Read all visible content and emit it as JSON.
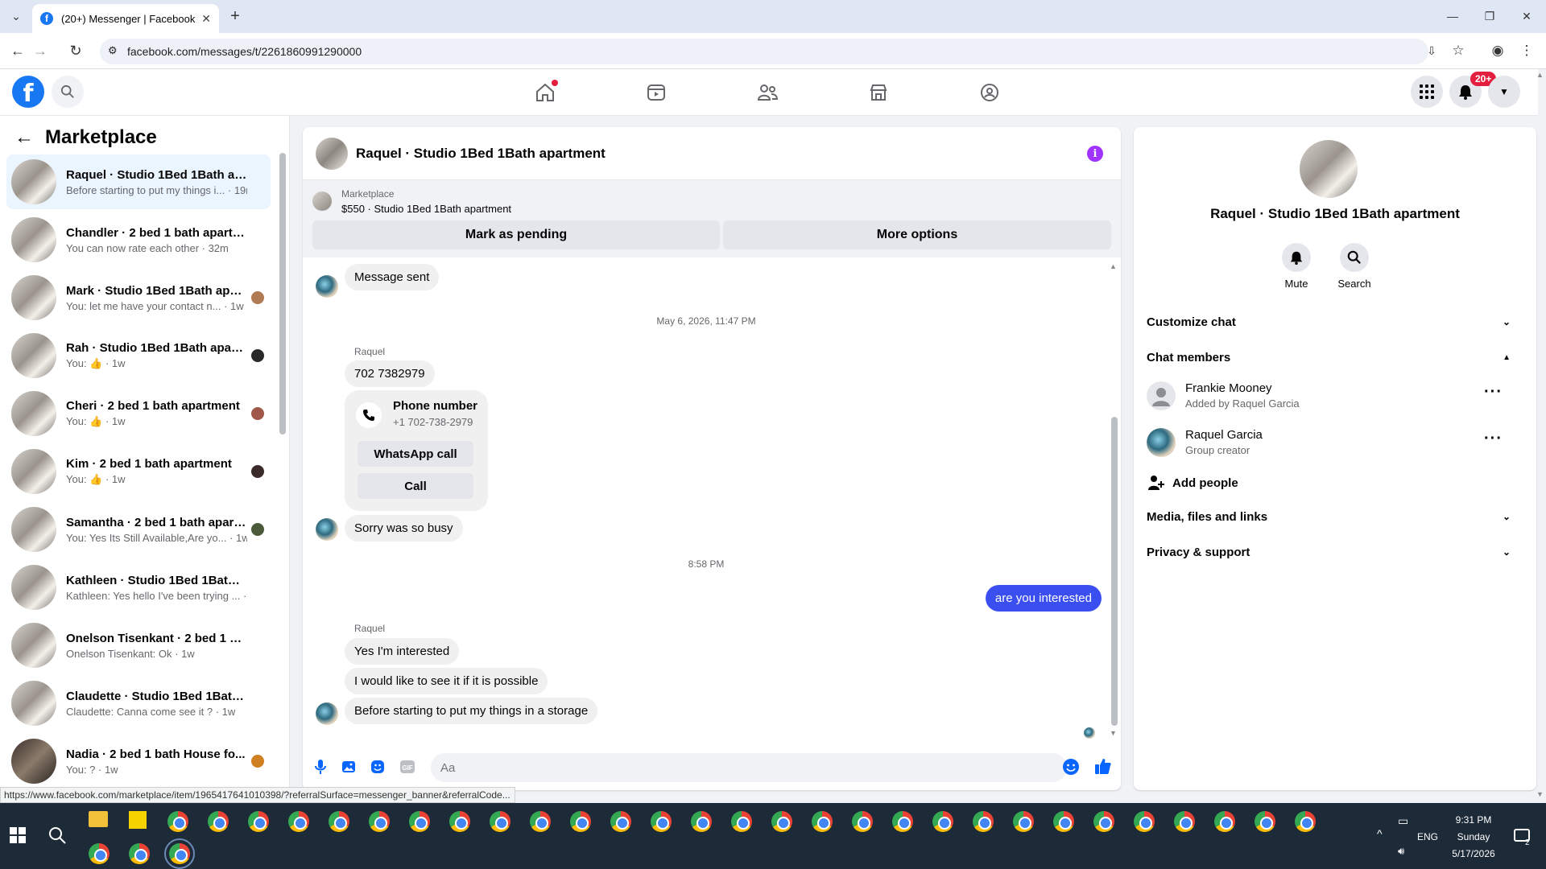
{
  "browser": {
    "tab_title": "(20+) Messenger | Facebook",
    "url": "facebook.com/messages/t/2261860991290000",
    "status_url": "https://www.facebook.com/marketplace/item/1965417641010398/?referralSurface=messenger_banner&referralCode..."
  },
  "fbnav": {
    "notification_badge": "20+"
  },
  "left_panel": {
    "title": "Marketplace",
    "conversations": [
      {
        "name": "Raquel · Studio 1Bed 1Bath apart...",
        "preview": "Before starting to put my things i... · 19m"
      },
      {
        "name": "Chandler · 2 bed 1 bath apartment",
        "preview": "You can now rate each other · 32m"
      },
      {
        "name": "Mark · Studio 1Bed 1Bath apar...",
        "preview": "You: let me have your contact n... · 1w"
      },
      {
        "name": "Rah · Studio 1Bed 1Bath apart...",
        "preview": "You: 👍 · 1w"
      },
      {
        "name": "Cheri · 2 bed 1 bath apartment",
        "preview": "You: 👍 · 1w"
      },
      {
        "name": "Kim · 2 bed 1 bath apartment",
        "preview": "You: 👍 · 1w"
      },
      {
        "name": "Samantha · 2 bed 1 bath apart...",
        "preview": "You: Yes Its Still Available,Are yo... · 1w"
      },
      {
        "name": "Kathleen · Studio 1Bed 1Bath ap...",
        "preview": "Kathleen: Yes hello I've been trying ... · 1w"
      },
      {
        "name": "Onelson Tisenkant · 2 bed 1 bat...",
        "preview": "Onelson Tisenkant: Ok · 1w"
      },
      {
        "name": "Claudette · Studio 1Bed 1Bath ap...",
        "preview": "Claudette: Canna come see it ? · 1w"
      },
      {
        "name": "Nadia · 2 bed 1 bath House fo...",
        "preview": "You: ? · 1w"
      }
    ]
  },
  "chat": {
    "title": "Raquel · Studio 1Bed 1Bath apartment",
    "banner_label": "Marketplace",
    "banner_listing": "$550 · Studio 1Bed 1Bath apartment",
    "mark_pending": "Mark as pending",
    "more_options": "More options",
    "msg_sent": "Message sent",
    "stamp1": "May 6, 2026, 11:47 PM",
    "sender": "Raquel",
    "phone_msg": "702 7382979",
    "phone_card_title": "Phone number",
    "phone_card_number": "+1 702-738-2979",
    "whatsapp_call": "WhatsApp call",
    "call": "Call",
    "sorry": "Sorry was so busy",
    "stamp2": "8:58 PM",
    "mine": "are you interested",
    "reply1": "Yes I'm interested",
    "reply2": "I would like to see it if it is possible",
    "reply3": "Before starting to put my things in a storage",
    "input_placeholder": "Aa"
  },
  "right_panel": {
    "title": "Raquel · Studio 1Bed 1Bath apartment",
    "mute": "Mute",
    "search": "Search",
    "customize": "Customize chat",
    "members_header": "Chat members",
    "members": [
      {
        "name": "Frankie Mooney",
        "sub": "Added by Raquel Garcia"
      },
      {
        "name": "Raquel Garcia",
        "sub": "Group creator"
      }
    ],
    "add_people": "Add people",
    "media": "Media, files and links",
    "privacy": "Privacy & support"
  },
  "taskbar": {
    "time": "9:31 PM",
    "day": "Sunday",
    "date": "5/17/2026",
    "lang": "ENG",
    "notif_count": "2"
  },
  "colors": {
    "fb_blue": "#1877f2",
    "my_bubble": "#3b4ef0",
    "info_purple": "#a033ff"
  }
}
